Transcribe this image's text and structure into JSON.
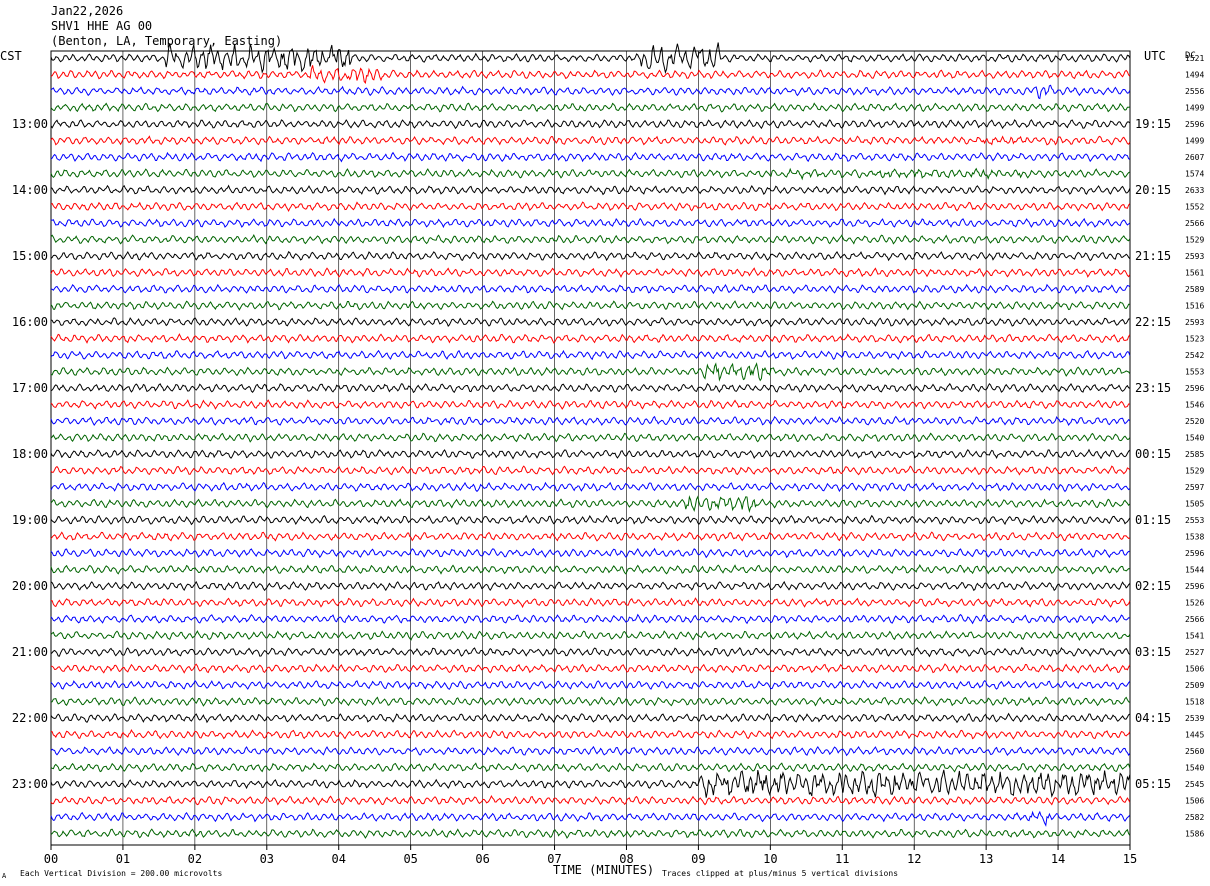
{
  "header": {
    "date": "Jan22,2026",
    "station": "SHV1 HHE AG 00",
    "location": "(Benton, LA, Temporary, Easting)"
  },
  "left_tz": "CST",
  "right_tz": "UTC",
  "dc_label": "DC",
  "footer": {
    "note_left": "Each Vertical Division =  200.00 microvolts",
    "xlabel": "TIME (MINUTES)",
    "note_right": "Traces clipped at plus/minus 5 vertical divisions",
    "logo": "A"
  },
  "colors": {
    "black": "#000000",
    "red": "#ff0000",
    "blue": "#0000ff",
    "green": "#006400",
    "grid": "#000000"
  },
  "chart_data": {
    "type": "line",
    "title": "SHV1 HHE AG 00",
    "xlabel": "TIME (MINUTES)",
    "x_ticks": [
      "00",
      "01",
      "02",
      "03",
      "04",
      "05",
      "06",
      "07",
      "08",
      "09",
      "10",
      "11",
      "12",
      "13",
      "14",
      "15"
    ],
    "xlim": [
      0,
      15
    ],
    "rows_per_hour": 4,
    "series_colors": [
      "black",
      "red",
      "blue",
      "green"
    ],
    "left_hour_labels": [
      "13:00",
      "14:00",
      "15:00",
      "16:00",
      "17:00",
      "18:00",
      "19:00",
      "20:00",
      "21:00",
      "22:00",
      "23:00"
    ],
    "right_hour_labels": [
      "19:15",
      "20:15",
      "21:15",
      "22:15",
      "23:15",
      "00:15",
      "01:15",
      "02:15",
      "03:15",
      "04:15",
      "05:15"
    ],
    "dc_offsets": [
      "1521",
      "1494",
      "2556",
      "1499",
      "2596",
      "1499",
      "2607",
      "1574",
      "2633",
      "1552",
      "2566",
      "1529",
      "2593",
      "1561",
      "2589",
      "1516",
      "2593",
      "1523",
      "2542",
      "1553",
      "2596",
      "1546",
      "2520",
      "1540",
      "2585",
      "1529",
      "2597",
      "1505",
      "2553",
      "1538",
      "2596",
      "1544",
      "2596",
      "1526",
      "2566",
      "1541",
      "2527",
      "1506",
      "2509",
      "1518",
      "2539",
      "1445",
      "2560",
      "1540",
      "2545",
      "1506",
      "2582",
      "1586"
    ],
    "events": [
      {
        "row": 0,
        "minute_start": 1.6,
        "minute_end": 4.2,
        "level": "high"
      },
      {
        "row": 0,
        "minute_start": 8.2,
        "minute_end": 9.3,
        "level": "high"
      },
      {
        "row": 1,
        "minute_start": 3.6,
        "minute_end": 4.6,
        "level": "medium"
      },
      {
        "row": 2,
        "minute_start": 13.6,
        "minute_end": 13.9,
        "level": "medium"
      },
      {
        "row": 5,
        "minute_start": 12.8,
        "minute_end": 14.0,
        "level": "low"
      },
      {
        "row": 7,
        "minute_start": 10.0,
        "minute_end": 13.5,
        "level": "low"
      },
      {
        "row": 19,
        "minute_start": 9.0,
        "minute_end": 10.0,
        "level": "medium"
      },
      {
        "row": 27,
        "minute_start": 8.8,
        "minute_end": 9.8,
        "level": "medium"
      },
      {
        "row": 44,
        "minute_start": 9.0,
        "minute_end": 15.0,
        "level": "high"
      },
      {
        "row": 46,
        "minute_start": 13.6,
        "minute_end": 13.9,
        "level": "medium"
      }
    ]
  }
}
